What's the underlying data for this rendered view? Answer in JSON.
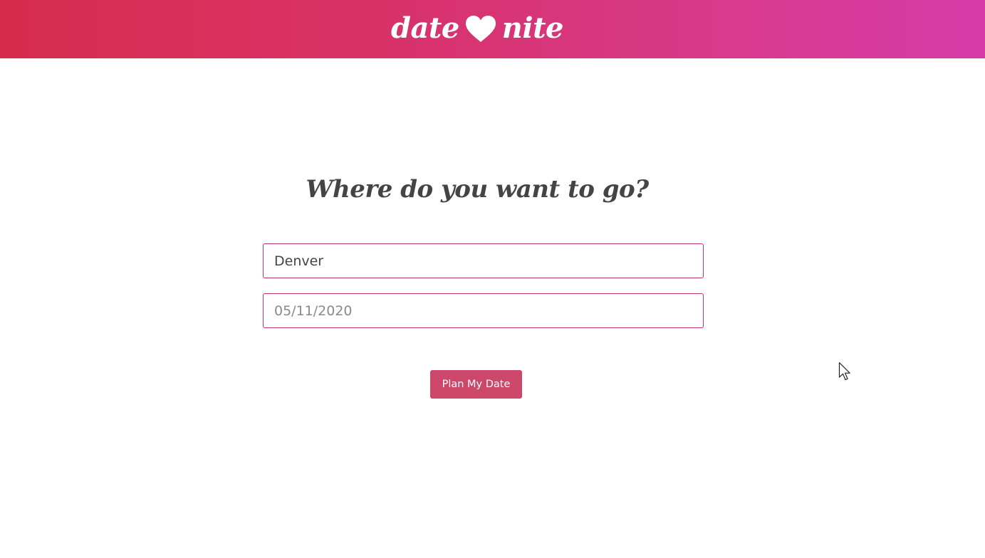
{
  "header": {
    "logo_left": "date",
    "logo_icon": "heart-icon",
    "logo_right": "nite",
    "gradient_start": "#d62d4c",
    "gradient_end": "#d63aa8"
  },
  "main": {
    "title": "Where do you want to go?",
    "location_value": "Denver",
    "date_placeholder": "05/11/2020",
    "submit_label": "Plan My Date",
    "accent_color": "#cc4769",
    "field_border_color": "#c0306a"
  },
  "pointer": {
    "icon": "mouse-cursor-icon"
  }
}
